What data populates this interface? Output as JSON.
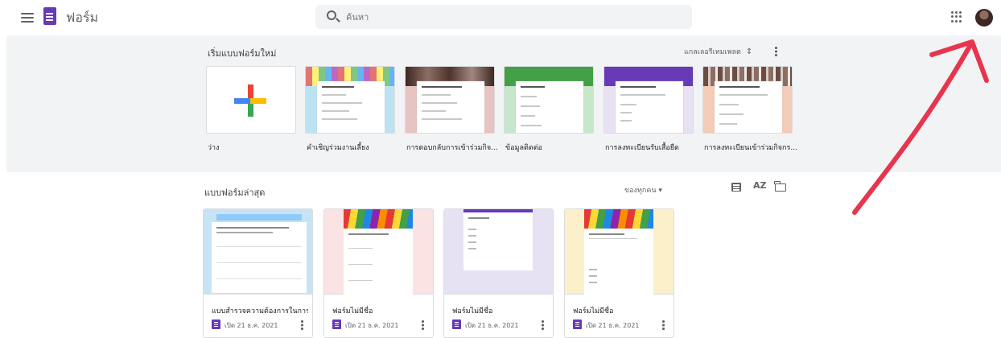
{
  "header": {
    "app_title": "ฟอร์ม",
    "search_placeholder": "ค้นหา",
    "menu_icon": "hamburger-menu-icon",
    "apps_icon": "google-apps-grid-icon"
  },
  "templates": {
    "section_title": "เริ่มแบบฟอร์มใหม่",
    "gallery_label": "แกลเลอรีเทมเพลต",
    "items": [
      {
        "label": "ว่าง",
        "kind": "blank"
      },
      {
        "label": "คำเชิญร่วมงานเลี้ยง",
        "kind": "party",
        "bg": "#bde3f3"
      },
      {
        "label": "การตอบกลับการเข้าร่วมกิจ...",
        "kind": "rsvp",
        "bg": "#e7c3c1"
      },
      {
        "label": "ข้อมูลติดต่อ",
        "kind": "contact",
        "bg": "#c8e6c9",
        "header": "#43a047"
      },
      {
        "label": "การลงทะเบียนรับเสื้อยืด",
        "kind": "tshirt",
        "bg": "#e8e1f2",
        "header": "#673ab7"
      },
      {
        "label": "การลงทะเบียนเข้าร่วมกิจกร...",
        "kind": "event",
        "bg": "#f3cbb6"
      }
    ]
  },
  "recent": {
    "section_title": "แบบฟอร์มล่าสุด",
    "owner_filter": "ของทุกคน ▾",
    "sort_icon_text": "AZ",
    "items": [
      {
        "name": "แบบสำรวจความต้องการในการ...",
        "date": "เปิด 21 ธ.ค. 2021",
        "bg": "#c6e4f5"
      },
      {
        "name": "ฟอร์มไม่มีชื่อ",
        "date": "เปิด 21 ธ.ค. 2021",
        "bg": "#fbe3e4"
      },
      {
        "name": "ฟอร์มไม่มีชื่อ",
        "date": "เปิด 21 ธ.ค. 2021",
        "bg": "#e6e2f4"
      },
      {
        "name": "ฟอร์มไม่มีชื่อ",
        "date": "เปิด 21 ธ.ค. 2021",
        "bg": "#fbf0c9"
      }
    ]
  },
  "colors": {
    "brand_purple": "#673ab7",
    "annotation_arrow": "#e8344c"
  }
}
